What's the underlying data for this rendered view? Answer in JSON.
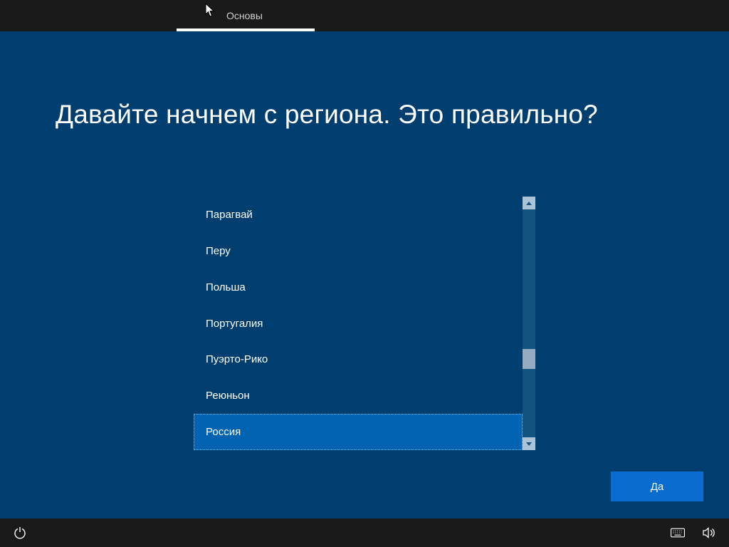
{
  "topbar": {
    "breadcrumb": "Основы"
  },
  "heading": "Давайте начнем с региона. Это правильно?",
  "regions": [
    {
      "label": "Парагвай",
      "selected": false
    },
    {
      "label": "Перу",
      "selected": false
    },
    {
      "label": "Польша",
      "selected": false
    },
    {
      "label": "Португалия",
      "selected": false
    },
    {
      "label": "Пуэрто-Рико",
      "selected": false
    },
    {
      "label": "Реюньон",
      "selected": false
    },
    {
      "label": "Россия",
      "selected": true
    }
  ],
  "confirm_label": "Да"
}
